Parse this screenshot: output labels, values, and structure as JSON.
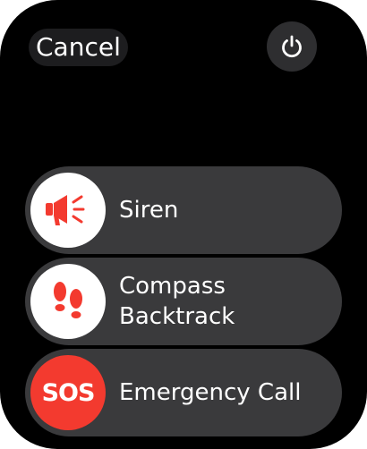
{
  "header": {
    "cancel_label": "Cancel"
  },
  "actions": [
    {
      "label": "Siren",
      "icon": "megaphone-icon"
    },
    {
      "label_lines": [
        "Compass",
        "Backtrack"
      ],
      "icon": "footprints-icon"
    },
    {
      "label": "Emergency Call",
      "icon_text": "SOS"
    }
  ],
  "colors": {
    "background": "#000000",
    "row_background": "#3a3a3c",
    "accent_red": "#f33a2f",
    "icon_circle": "#ffffff"
  }
}
